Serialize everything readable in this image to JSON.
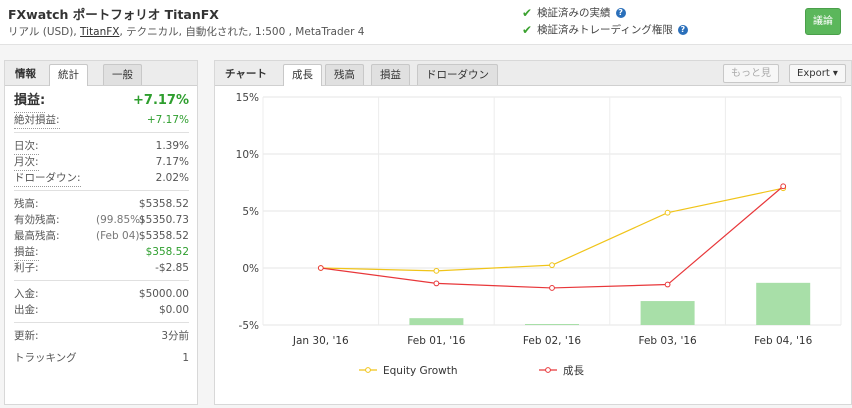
{
  "header": {
    "title": "FXwatch ポートフォリオ TitanFX",
    "sub_prefix": "リアル (USD),",
    "sub_broker": "TitanFX",
    "sub_rest": ", テクニカル, 自動化された, 1:500 , MetaTrader 4",
    "verified_1": "検証済みの実績",
    "verified_2": "検証済みトレーディング権限",
    "discuss_label": "議論"
  },
  "left_panel": {
    "tabs": [
      "情報",
      "統計",
      "一般"
    ],
    "gain": {
      "label": "損益:",
      "value": "+7.17%"
    },
    "abs_gain": {
      "label": "絶対損益:",
      "value": "+7.17%"
    },
    "daily": {
      "label": "日次:",
      "value": "1.39%"
    },
    "monthly": {
      "label": "月次:",
      "value": "7.17%"
    },
    "drawdown": {
      "label": "ドローダウン:",
      "value": "2.02%"
    },
    "balance": {
      "label": "残高:",
      "value": "$5358.52"
    },
    "equity": {
      "label": "有効残高:",
      "note": "(99.85%)",
      "value": "$5350.73"
    },
    "highest": {
      "label": "最高残高:",
      "note": "(Feb 04)",
      "value": "$5358.52"
    },
    "profit": {
      "label": "損益:",
      "value": "$358.52"
    },
    "interest": {
      "label": "利子:",
      "value": "-$2.85"
    },
    "deposits": {
      "label": "入金:",
      "value": "$5000.00"
    },
    "withdrawals": {
      "label": "出金:",
      "value": "$0.00"
    },
    "updated": {
      "label": "更新:",
      "value": "3分前"
    },
    "tracking": {
      "label": "トラッキング",
      "value": "1"
    }
  },
  "right_panel": {
    "tabs": [
      "チャート",
      "成長",
      "残高",
      "損益",
      "ドローダウン"
    ],
    "more_label": "もっと見",
    "export_label": "Export"
  },
  "chart_data": {
    "type": "line",
    "categories": [
      "Jan 30, '16",
      "Feb 01, '16",
      "Feb 02, '16",
      "Feb 03, '16",
      "Feb 04, '16"
    ],
    "ylim": [
      -5,
      15
    ],
    "yticks": [
      "15%",
      "10%",
      "5%",
      "0%",
      "-5%"
    ],
    "series": [
      {
        "name": "Equity Growth",
        "type": "line",
        "color": "#f0c419",
        "values": [
          0,
          -0.25,
          0.25,
          4.85,
          7.0
        ]
      },
      {
        "name": "成長",
        "type": "line",
        "color": "#e8373a",
        "values": [
          0,
          -1.35,
          -1.75,
          -1.45,
          7.17
        ]
      },
      {
        "type": "bar",
        "color": "#a8dfa8",
        "values": [
          null,
          0.6,
          0.0,
          2.1,
          3.7
        ]
      }
    ]
  }
}
